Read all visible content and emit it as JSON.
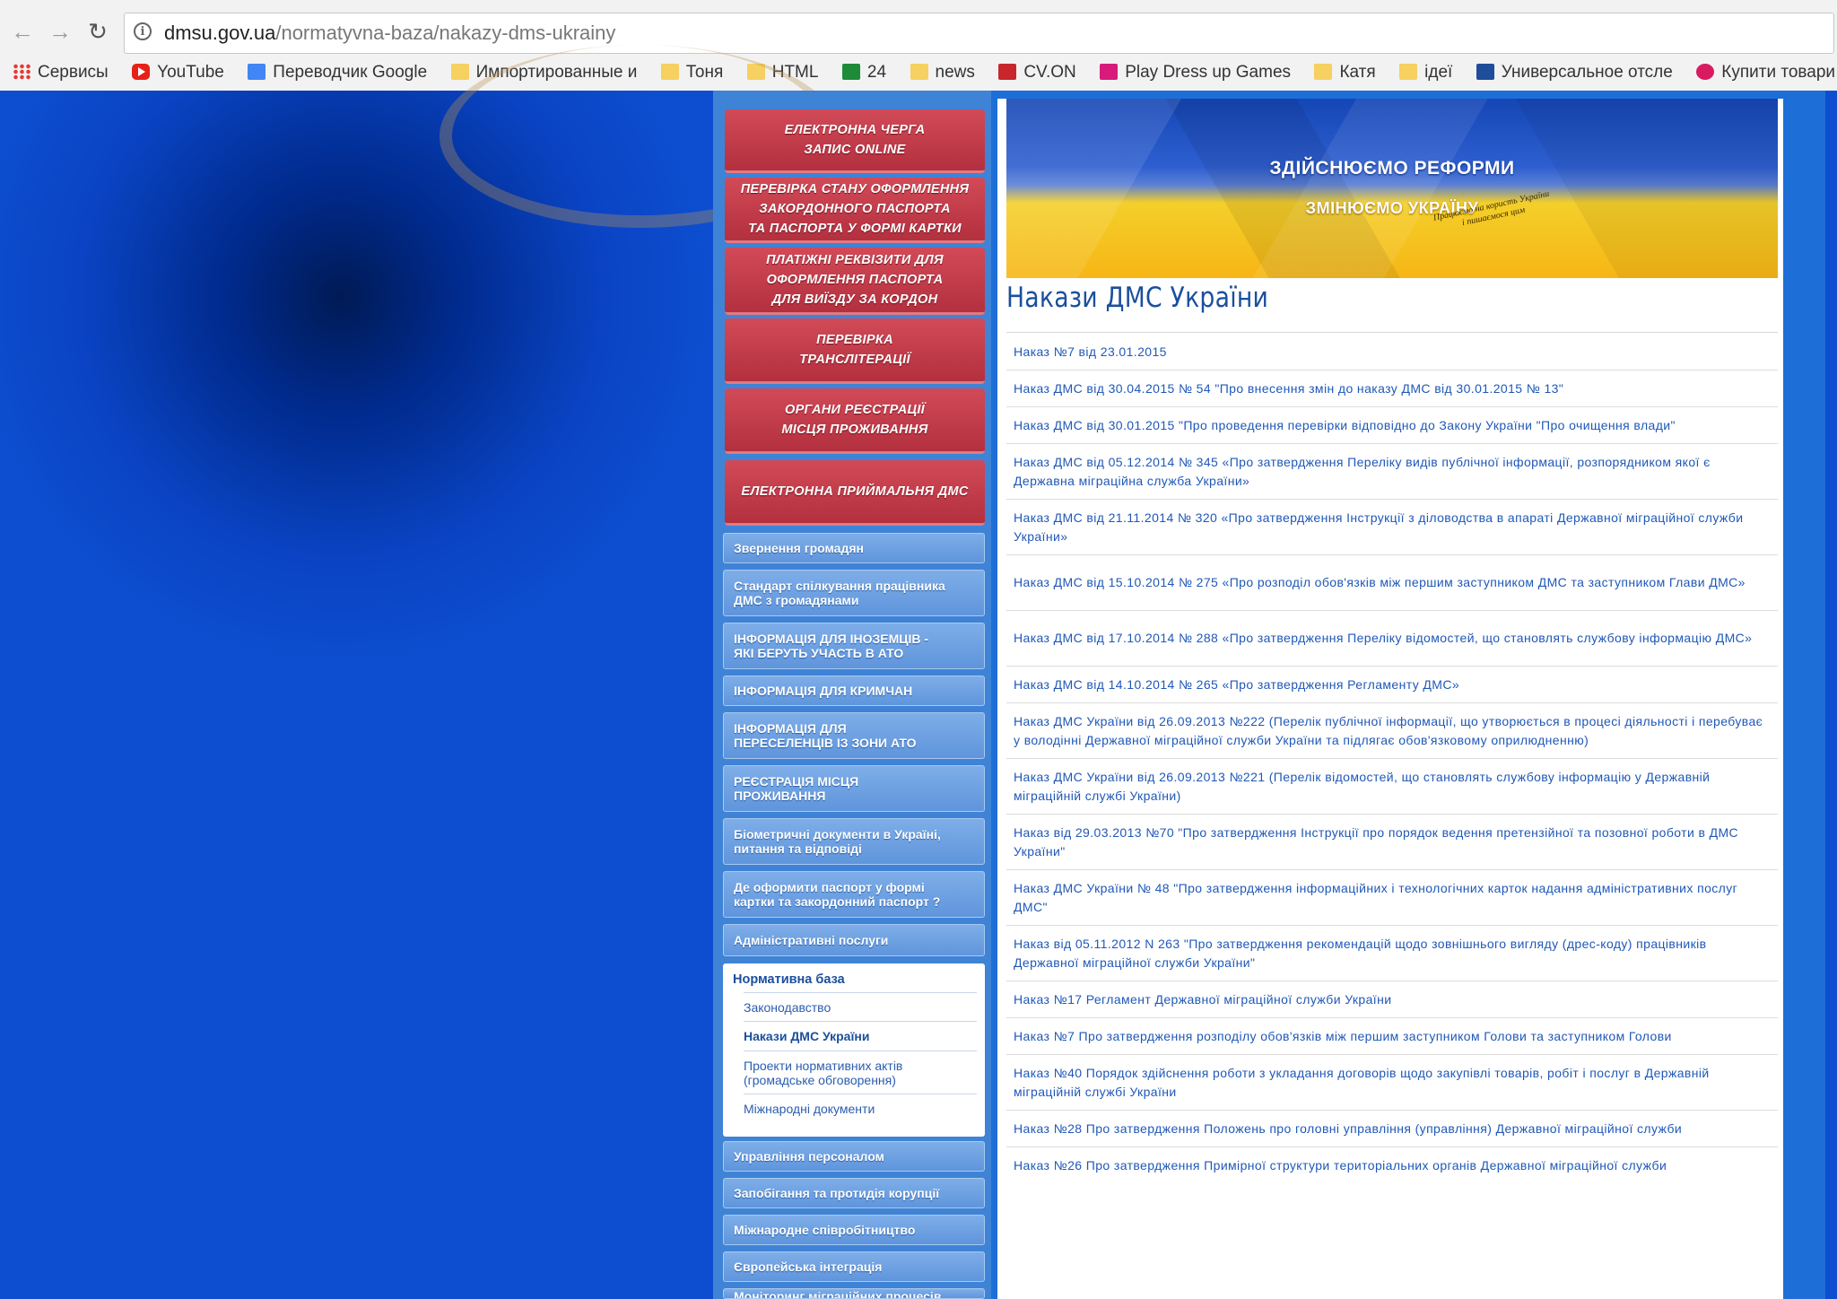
{
  "browser": {
    "url_domain": "dmsu.gov.ua",
    "url_path": "/normatyvna-baza/nakazy-dms-ukrainy",
    "bookmarks": [
      {
        "label": "Сервисы",
        "icon": "apps-icon"
      },
      {
        "label": "YouTube",
        "icon": "youtube-icon"
      },
      {
        "label": "Переводчик Google",
        "icon": "google-translate-icon"
      },
      {
        "label": "Импортированные и",
        "icon": "folder-icon"
      },
      {
        "label": "Тоня",
        "icon": "folder-icon"
      },
      {
        "label": "HTML",
        "icon": "folder-icon"
      },
      {
        "label": "24",
        "icon": "green-bookmark-icon"
      },
      {
        "label": "news",
        "icon": "folder-icon"
      },
      {
        "label": "CV.ON",
        "icon": "cvon-icon"
      },
      {
        "label": "Play Dress up Games",
        "icon": "dressup-icon"
      },
      {
        "label": "Катя",
        "icon": "folder-icon"
      },
      {
        "label": "ідеї",
        "icon": "folder-icon"
      },
      {
        "label": "Универсальное отсле",
        "icon": "universal-icon"
      },
      {
        "label": "Купити товари для д",
        "icon": "heart-icon"
      },
      {
        "label": "",
        "icon": "facebook-icon"
      }
    ]
  },
  "sidebar": {
    "red_buttons": [
      "ЕЛЕКТРОННА ЧЕРГА\nзапис online",
      "ПЕРЕВІРКА СТАНУ ОФОРМЛЕННЯ\nЗАКОРДОННОГО ПАСПОРТА\nТА ПАСПОРТА У ФОРМІ КАРТКИ",
      "ПЛАТІЖНІ РЕКВІЗИТИ ДЛЯ\nОФОРМЛЕННЯ ПАСПОРТА\nДЛЯ ВИЇЗДУ ЗА КОРДОН",
      "ПЕРЕВІРКА\nТРАНСЛІТЕРАЦІЇ",
      "ОРГАНИ РЕЄСТРАЦІЇ\nМІСЦЯ ПРОЖИВАННЯ",
      "ЕЛЕКТРОННА ПРИЙМАЛЬНЯ ДМС"
    ],
    "menu_items": [
      "Звернення громадян",
      "Стандарт спілкування працівника\nДМС з громадянами",
      "ІНФОРМАЦІЯ ДЛЯ ІНОЗЕМЦІВ -\nЯКІ БЕРУТЬ УЧАСТЬ В АТО",
      "ІНФОРМАЦІЯ ДЛЯ КРИМЧАН",
      "ІНФОРМАЦІЯ ДЛЯ\nПЕРЕСЕЛЕНЦІВ ІЗ ЗОНИ АТО",
      "РЕЄСТРАЦІЯ МІСЦЯ\nПРОЖИВАННЯ",
      "Біометричні документи в Україні,\nпитання та відповіді",
      "Де оформити паспорт у формі\nкартки та закордонний паспорт ?",
      "Адміністративні послуги"
    ],
    "submenu": {
      "title": "Нормативна база",
      "items": [
        "Законодавство",
        "Накази ДМС України",
        "Проекти нормативних актів\n(громадське обговорення)",
        "Міжнародні документи"
      ]
    },
    "menu_items_after": [
      "Управління персоналом",
      "Запобігання та протидія корупції",
      "Міжнародне співробітництво",
      "Європейська інтеграція",
      "Моніторинг міграційних процесів"
    ]
  },
  "banner": {
    "line1": "ЗДІЙСНЮЄМО РЕФОРМИ",
    "line2": "ЗМІНЮЄМО УКРАЇНУ",
    "line3": "Працюємо на користь України\nі пишаємося цим"
  },
  "main": {
    "title": "Накази ДМС України",
    "orders": [
      "Наказ №7 від 23.01.2015",
      "Наказ ДМС від 30.04.2015 № 54 \"Про внесення змін до наказу ДМС від 30.01.2015 № 13\"",
      "Наказ ДМС від 30.01.2015 \"Про проведення перевірки відповідно до Закону України \"Про очищення влади\"",
      "Наказ ДМС від 05.12.2014 № 345 «Про затвердження Переліку видів публічної інформації, розпорядником якої є Державна міграційна служба України»",
      "Наказ ДМС від 21.11.2014 № 320 «Про затвердження Інструкції з діловодства в апараті Державної міграційної служби України»",
      "Наказ ДМС від 15.10.2014 № 275 «Про розподіл обов'язків між першим заступником ДМС та заступником Глави ДМС»",
      "Наказ ДМС від 17.10.2014 № 288 «Про затвердження Переліку відомостей, що становлять службову інформацію ДМС»",
      "Наказ ДМС від 14.10.2014 № 265 «Про затвердження Регламенту ДМС»",
      "Наказ ДМС України від 26.09.2013 №222 (Перелік публічної інформації, що утворюється в процесі діяльності і перебуває у володінні Державної міграційної служби України та підлягає обов'язковому оприлюдненню)",
      "Наказ ДМС України від 26.09.2013 №221 (Перелік відомостей, що становлять службову інформацію у Державній міграційній службі України)",
      "Наказ від 29.03.2013 №70 \"Про затвердження Інструкції про порядок ведення претензійної та позовної роботи в ДМС України\"",
      "Наказ ДМС України № 48 \"Про затвердження інформаційних і технологічних карток надання адміністративних послуг ДМС\"",
      "Наказ від 05.11.2012 N 263 \"Про затвердження рекомендацій щодо зовнішнього вигляду (дрес-коду) працівників Державної міграційної служби України\"",
      "Наказ №17 Регламент Державної міграційної служби України",
      "Наказ №7 Про затвердження розподілу обов'язків між першим заступником Голови та заступником Голови",
      "Наказ №40 Порядок здійснення роботи з укладання договорів щодо закупівлі товарів, робіт і послуг в Державній міграційній службі України",
      "Наказ №28 Про затвердження Положень про головні управління (управління) Державної міграційної служби",
      "Наказ №26 Про затвердження Примірної структури територіальних органів Державної міграційної служби"
    ]
  }
}
